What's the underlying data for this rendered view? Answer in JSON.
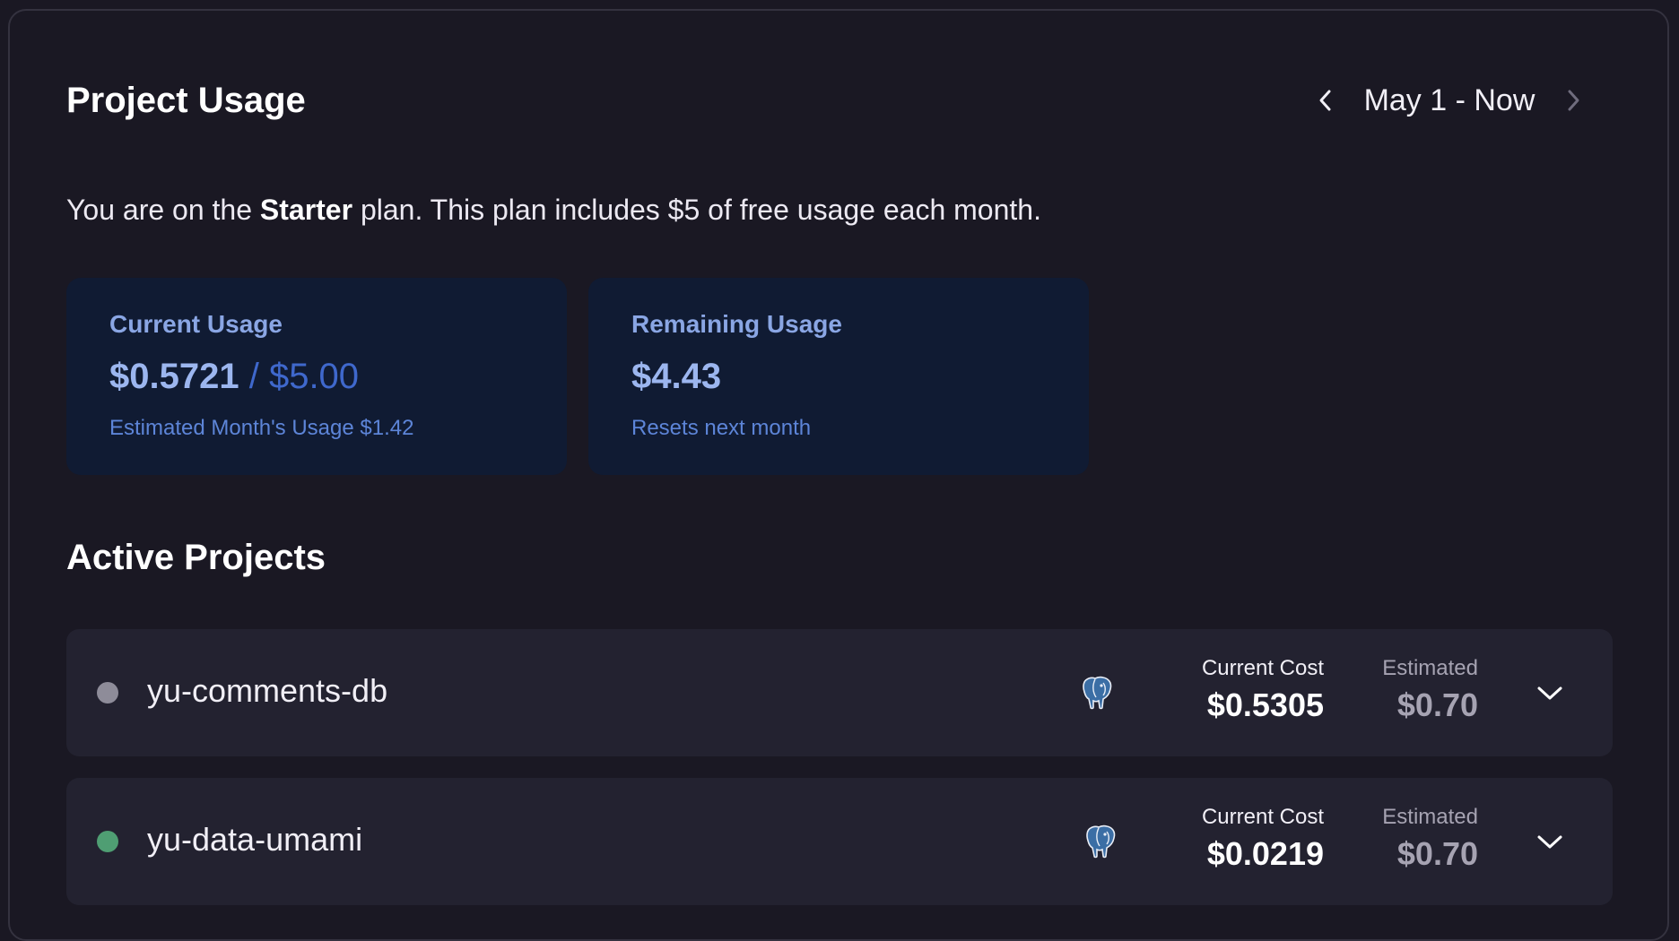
{
  "header": {
    "title": "Project Usage",
    "date_range": "May 1 - Now",
    "prev_icon": "chevron-left-icon",
    "next_icon": "chevron-right-icon"
  },
  "plan": {
    "text_before": "You are on the ",
    "plan_name": "Starter",
    "text_after": " plan. This plan includes $5 of free usage each month."
  },
  "cards": {
    "current": {
      "label": "Current Usage",
      "value": "$0.5721",
      "limit": "/ $5.00",
      "sub": "Estimated Month's Usage $1.42"
    },
    "remaining": {
      "label": "Remaining Usage",
      "value": "$4.43",
      "sub": "Resets next month"
    }
  },
  "projects_section": {
    "title": "Active Projects",
    "projects": [
      {
        "name": "yu-comments-db",
        "status_color": "#8e8c99",
        "icon": "postgres-elephant-icon",
        "current_cost_label": "Current Cost",
        "current_cost": "$0.5305",
        "estimated_label": "Estimated",
        "estimated": "$0.70"
      },
      {
        "name": "yu-data-umami",
        "status_color": "#4f9e73",
        "icon": "postgres-elephant-icon",
        "current_cost_label": "Current Cost",
        "current_cost": "$0.0219",
        "estimated_label": "Estimated",
        "estimated": "$0.70"
      }
    ]
  },
  "colors": {
    "background": "#1a1823",
    "card_background": "#101b33",
    "row_background": "#232230",
    "accent_blue": "#8aa6e4"
  }
}
